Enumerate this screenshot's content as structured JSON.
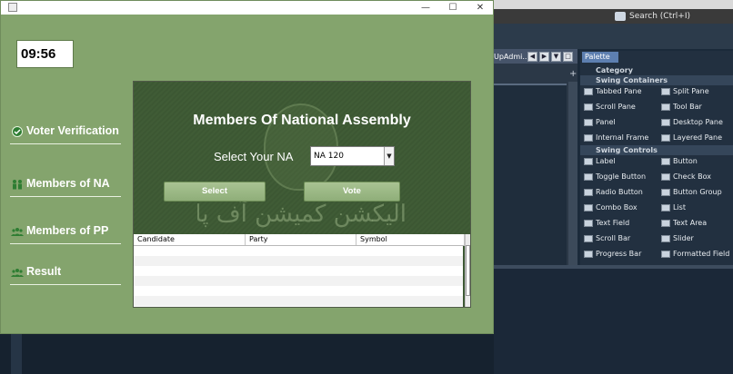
{
  "ide": {
    "search_placeholder": "Search (Ctrl+I)",
    "editor_tab": "UpAdmi...",
    "palette": {
      "tab_label": "Palette",
      "category_label": "Category",
      "sections": [
        {
          "title": "Swing Containers",
          "items": [
            "Tabbed Pane",
            "Split Pane",
            "Scroll Pane",
            "Tool Bar",
            "Panel",
            "Desktop Pane",
            "Internal Frame",
            "Layered Pane"
          ]
        },
        {
          "title": "Swing Controls",
          "items": [
            "Label",
            "Button",
            "Toggle Button",
            "Check Box",
            "Radio Button",
            "Button Group",
            "Combo Box",
            "List",
            "Text Field",
            "Text Area",
            "Scroll Bar",
            "Slider",
            "Progress Bar",
            "Formatted Field"
          ]
        }
      ]
    }
  },
  "app": {
    "clock": "09:56",
    "nav": [
      {
        "label": "Voter Verification",
        "icon": "check-shield-icon"
      },
      {
        "label": "Members of NA",
        "icon": "people-icon"
      },
      {
        "label": "Members of PP",
        "icon": "group-icon"
      },
      {
        "label": "Result",
        "icon": "group-icon"
      }
    ],
    "panel": {
      "title": "Members Of National Assembly",
      "select_label": "Select Your NA",
      "selected_na": "NA 120",
      "select_button": "Select",
      "vote_button": "Vote",
      "banner_text": "الیکشن کمیشن آف پاکستان"
    },
    "table": {
      "columns": [
        "Candidate",
        "Party",
        "Symbol"
      ],
      "rows": []
    }
  },
  "colors": {
    "window_bg": "#84a46d",
    "panel_bg": "#3d5834",
    "button_green": "#9bb886"
  }
}
